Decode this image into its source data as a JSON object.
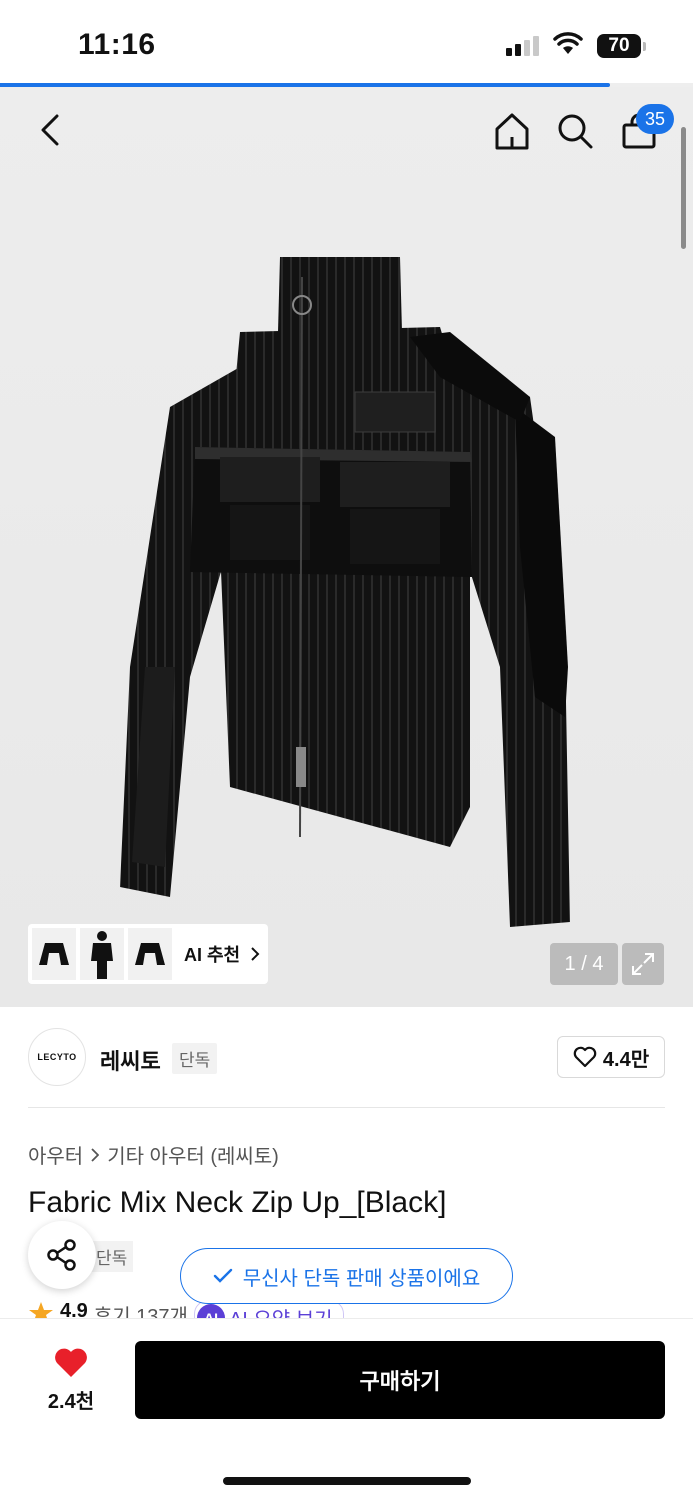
{
  "status_bar": {
    "time": "11:16",
    "battery": "70",
    "signal_bars": 2,
    "signal_total": 4
  },
  "page_progress": 0.88,
  "nav": {
    "cart_count": "35",
    "icons": [
      "back-icon",
      "home-icon",
      "search-icon",
      "shopping-bag-icon"
    ]
  },
  "gallery": {
    "ai_recommend_label": "AI 추천",
    "page_counter": "1 / 4",
    "thumbnails": [
      "jacket-thumb-1",
      "model-thumb",
      "jacket-thumb-2"
    ]
  },
  "brand": {
    "logo_text": "LECYTO",
    "name": "레씨토",
    "tag": "단독",
    "likes": "4.4만"
  },
  "breadcrumb": {
    "category": "아우터",
    "subcategory": "기타 아우터 (레씨토)"
  },
  "product": {
    "title": "Fabric Mix Neck Zip Up_[Black]",
    "exclusive_tag": "단독",
    "exclusive_notice": "무신사 단독 판매 상품이에요"
  },
  "rating": {
    "value": "4.9",
    "reviews": "후기 137개",
    "ai_summary": "AI 요약 보기",
    "ai_badge": "AI"
  },
  "bottom_bar": {
    "wish_count": "2.4천",
    "buy_label": "구매하기"
  },
  "colors": {
    "accent": "#1a73e8",
    "heart": "#e8202a",
    "buy": "#000000",
    "star": "#f5a623"
  }
}
